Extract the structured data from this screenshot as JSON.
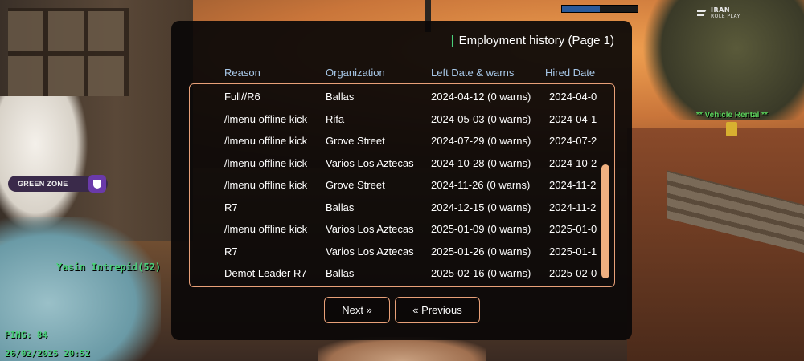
{
  "hud": {
    "logo_line1": "IRAN",
    "logo_line2": "ROLE PLAY",
    "zone_label": "GREEN ZONE",
    "player_tag": "Yasin Intrepid(52)",
    "vehicle_rental": "**  Vehicle Rental **",
    "ping": "PING: 84",
    "datetime": "26/02/2025 20:52",
    "colors": {
      "hud_green": "#4ad07a",
      "zone_purple": "#6a3aaa",
      "accent_peach": "#e8a078"
    }
  },
  "dialog": {
    "title_marker": "|",
    "title": "Employment history (Page 1)",
    "columns": [
      "Reason",
      "Organization",
      "Left Date & warns",
      "Hired Date"
    ],
    "rows": [
      {
        "reason": "Full//R6",
        "org": "Ballas",
        "left": "2024-04-12 (0 warns)",
        "hired": "2024-04-0"
      },
      {
        "reason": "/lmenu offline kick",
        "org": "Rifa",
        "left": "2024-05-03 (0 warns)",
        "hired": "2024-04-1"
      },
      {
        "reason": "/lmenu offline kick",
        "org": "Grove Street",
        "left": "2024-07-29 (0 warns)",
        "hired": "2024-07-2"
      },
      {
        "reason": "/lmenu offline kick",
        "org": "Varios Los Aztecas",
        "left": "2024-10-28 (0 warns)",
        "hired": "2024-10-2"
      },
      {
        "reason": "/lmenu offline kick",
        "org": "Grove Street",
        "left": "2024-11-26 (0 warns)",
        "hired": "2024-11-2"
      },
      {
        "reason": "R7",
        "org": "Ballas",
        "left": "2024-12-15 (0 warns)",
        "hired": "2024-11-2"
      },
      {
        "reason": "/lmenu offline kick",
        "org": "Varios Los Aztecas",
        "left": "2025-01-09 (0 warns)",
        "hired": "2025-01-0"
      },
      {
        "reason": "R7",
        "org": "Varios Los Aztecas",
        "left": "2025-01-26 (0 warns)",
        "hired": "2025-01-1"
      },
      {
        "reason": "Demot Leader R7",
        "org": "Ballas",
        "left": "2025-02-16 (0 warns)",
        "hired": "2025-02-0"
      }
    ],
    "next_label": "Next »",
    "prev_label": "« Previous"
  }
}
